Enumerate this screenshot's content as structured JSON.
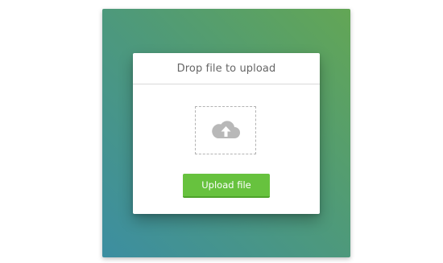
{
  "dialog": {
    "title": "Drop file to upload",
    "dropzone_icon": "cloud-upload-icon",
    "upload_button_label": "Upload file"
  },
  "colors": {
    "gradient_top_right": "#63a655",
    "gradient_bottom_left": "#3c8ea1",
    "button_green": "#67c23e",
    "icon_gray": "#b8b8b8"
  }
}
